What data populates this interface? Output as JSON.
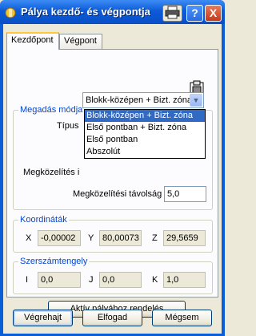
{
  "window": {
    "title": "Pálya kezdő- és végpontja",
    "help_label": "?",
    "close_label": "X"
  },
  "tabs": [
    {
      "label": "Kezdőpont",
      "active": true
    },
    {
      "label": "Végpont",
      "active": false
    }
  ],
  "mode_group": {
    "title": "Megadás módja",
    "type_label": "Típus",
    "type_value": "Blokk-középen + Bizt. zóna",
    "options": [
      "Blokk-középen + Bizt. zóna",
      "Első pontban + Bizt. zóna",
      "Első pontban",
      "Abszolút"
    ],
    "approach_label": "Megközelítés i",
    "approach_dist_label": "Megközelítési távolság",
    "approach_dist_value": "5,0"
  },
  "coords_group": {
    "title": "Koordináták",
    "x_label": "X",
    "x_value": "-0,00002",
    "y_label": "Y",
    "y_value": "80,00073",
    "z_label": "Z",
    "z_value": "29,5659"
  },
  "tool_axis_group": {
    "title": "Szerszámtengely",
    "i_label": "I",
    "i_value": "0,0",
    "j_label": "J",
    "j_value": "0,0",
    "k_label": "K",
    "k_value": "1,0"
  },
  "assign_button": "Aktív pályához rendelés",
  "footer": {
    "apply": "Végrehajt",
    "accept": "Elfogad",
    "cancel": "Mégsem"
  }
}
